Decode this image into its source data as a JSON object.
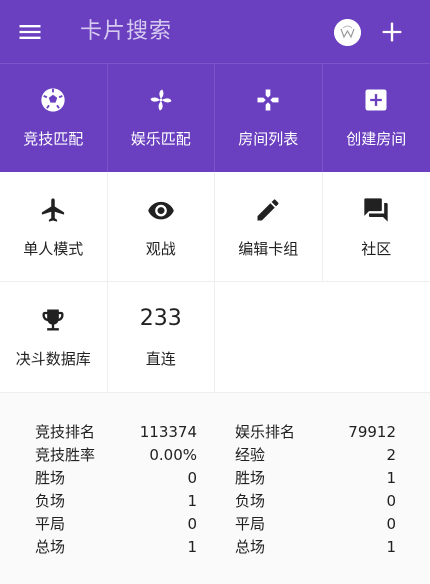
{
  "appbar": {
    "title": "卡片搜索",
    "icons": {
      "menu": "menu-icon",
      "avatar": "avatar",
      "add": "add-icon"
    }
  },
  "primary_actions": [
    {
      "label": "竞技匹配",
      "icon": "soccer-ball-icon"
    },
    {
      "label": "娱乐匹配",
      "icon": "pinwheel-icon"
    },
    {
      "label": "房间列表",
      "icon": "gamepad-icon"
    },
    {
      "label": "创建房间",
      "icon": "add-box-icon"
    }
  ],
  "secondary_actions": [
    {
      "label": "单人模式",
      "icon": "airplane-icon"
    },
    {
      "label": "观战",
      "icon": "eye-icon"
    },
    {
      "label": "编辑卡组",
      "icon": "pencil-icon"
    },
    {
      "label": "社区",
      "icon": "forum-icon"
    },
    {
      "label": "决斗数据库",
      "icon": "trophy-icon"
    },
    {
      "label": "直连",
      "number": "233"
    }
  ],
  "stats": {
    "left": [
      {
        "k": "竞技排名",
        "v": "113374"
      },
      {
        "k": "竞技胜率",
        "v": "0.00%"
      },
      {
        "k": "胜场",
        "v": "0"
      },
      {
        "k": "负场",
        "v": "1"
      },
      {
        "k": "平局",
        "v": "0"
      },
      {
        "k": "总场",
        "v": "1"
      }
    ],
    "right": [
      {
        "k": "娱乐排名",
        "v": "79912"
      },
      {
        "k": "经验",
        "v": "2"
      },
      {
        "k": "胜场",
        "v": "1"
      },
      {
        "k": "负场",
        "v": "0"
      },
      {
        "k": "平局",
        "v": "0"
      },
      {
        "k": "总场",
        "v": "1"
      }
    ]
  },
  "colors": {
    "primary": "#6a3fc0",
    "title_text": "#d7caf0",
    "on_primary": "#ffffff"
  }
}
